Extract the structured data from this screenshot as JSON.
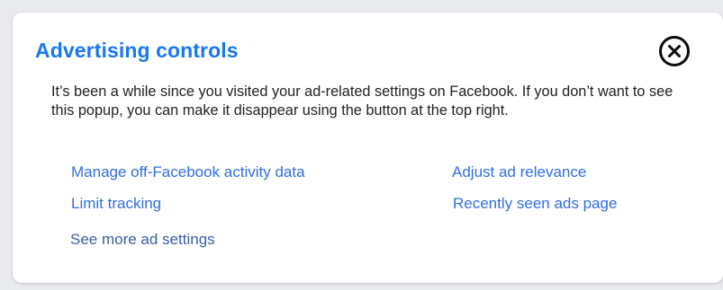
{
  "dialog": {
    "title": "Advertising controls",
    "description": "It’s been a while since you visited your ad-related settings on Facebook. If you don’t want to see this popup, you can make it disappear using the button at the top right.",
    "close_icon": "close-circle-icon"
  },
  "links": {
    "manage_off_facebook": "Manage off-Facebook activity data",
    "adjust_ad_relevance": "Adjust ad relevance",
    "limit_tracking": "Limit tracking",
    "recently_seen_ads": "Recently seen ads page",
    "see_more": "See more ad settings"
  },
  "colors": {
    "title": "#1877f2",
    "link": "#2f6fe0",
    "text": "#222222",
    "background": "#e9eaee",
    "card": "#ffffff"
  }
}
